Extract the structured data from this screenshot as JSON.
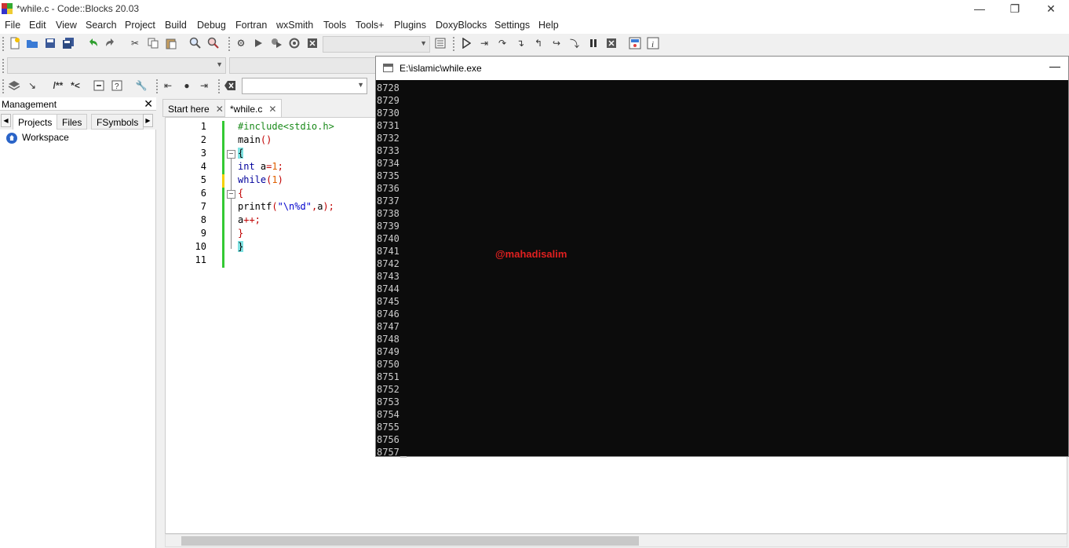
{
  "window": {
    "title": "*while.c - Code::Blocks 20.03",
    "minimize": "—",
    "maximize": "❐",
    "close": "✕"
  },
  "menu": [
    "File",
    "Edit",
    "View",
    "Search",
    "Project",
    "Build",
    "Debug",
    "Fortran",
    "wxSmith",
    "Tools",
    "Tools+",
    "Plugins",
    "DoxyBlocks",
    "Settings",
    "Help"
  ],
  "toolbar": {
    "comment_label": "/**",
    "uncomment_label": "*<"
  },
  "management": {
    "title": "Management",
    "close": "✕",
    "tabs": [
      "Projects",
      "Files",
      "FSymbols"
    ],
    "tree_root": "Workspace"
  },
  "editor": {
    "tabs": [
      {
        "label": "Start here",
        "close": "✕"
      },
      {
        "label": "*while.c",
        "close": "✕"
      }
    ],
    "line_numbers": [
      "1",
      "2",
      "3",
      "4",
      "5",
      "6",
      "7",
      "8",
      "9",
      "10",
      "11"
    ],
    "lines": [
      [
        {
          "t": "#include<stdio.h>",
          "c": "#1a8a1a"
        }
      ],
      [
        {
          "t": "main",
          "c": "#000"
        },
        {
          "t": "()",
          "c": "#c00000"
        }
      ],
      [
        {
          "t": "{",
          "c": "#000",
          "bg": "#7fe3e3"
        }
      ],
      [
        {
          "t": "int",
          "c": "#00009c"
        },
        {
          "t": " a",
          "c": "#000"
        },
        {
          "t": "=",
          "c": "#c00000"
        },
        {
          "t": "1",
          "c": "#e06000"
        },
        {
          "t": ";",
          "c": "#c00000"
        }
      ],
      [
        {
          "t": "while",
          "c": "#00009c"
        },
        {
          "t": "(",
          "c": "#c00000"
        },
        {
          "t": "1",
          "c": "#e06000"
        },
        {
          "t": ")",
          "c": "#c00000"
        }
      ],
      [
        {
          "t": "{",
          "c": "#c00000"
        }
      ],
      [
        {
          "t": "printf",
          "c": "#000"
        },
        {
          "t": "(",
          "c": "#c00000"
        },
        {
          "t": "\"\\n%d\"",
          "c": "#0000cc"
        },
        {
          "t": ",",
          "c": "#c00000"
        },
        {
          "t": "a",
          "c": "#000"
        },
        {
          "t": ");",
          "c": "#c00000"
        }
      ],
      [
        {
          "t": "a",
          "c": "#000"
        },
        {
          "t": "++;",
          "c": "#c00000"
        }
      ],
      [
        {
          "t": "}",
          "c": "#c00000"
        }
      ],
      [
        {
          "t": "}",
          "c": "#000",
          "bg": "#7fe3e3"
        }
      ],
      []
    ]
  },
  "console": {
    "title": "E:\\islamic\\while.exe",
    "minimize": "—",
    "lines": [
      "8728",
      "8729",
      "8730",
      "8731",
      "8732",
      "8733",
      "8734",
      "8735",
      "8736",
      "8737",
      "8738",
      "8739",
      "8740",
      "8741",
      "8742",
      "8743",
      "8744",
      "8745",
      "8746",
      "8747",
      "8748",
      "8749",
      "8750",
      "8751",
      "8752",
      "8753",
      "8754",
      "8755",
      "8756",
      "8757"
    ],
    "watermark": "@mahadisalim"
  }
}
